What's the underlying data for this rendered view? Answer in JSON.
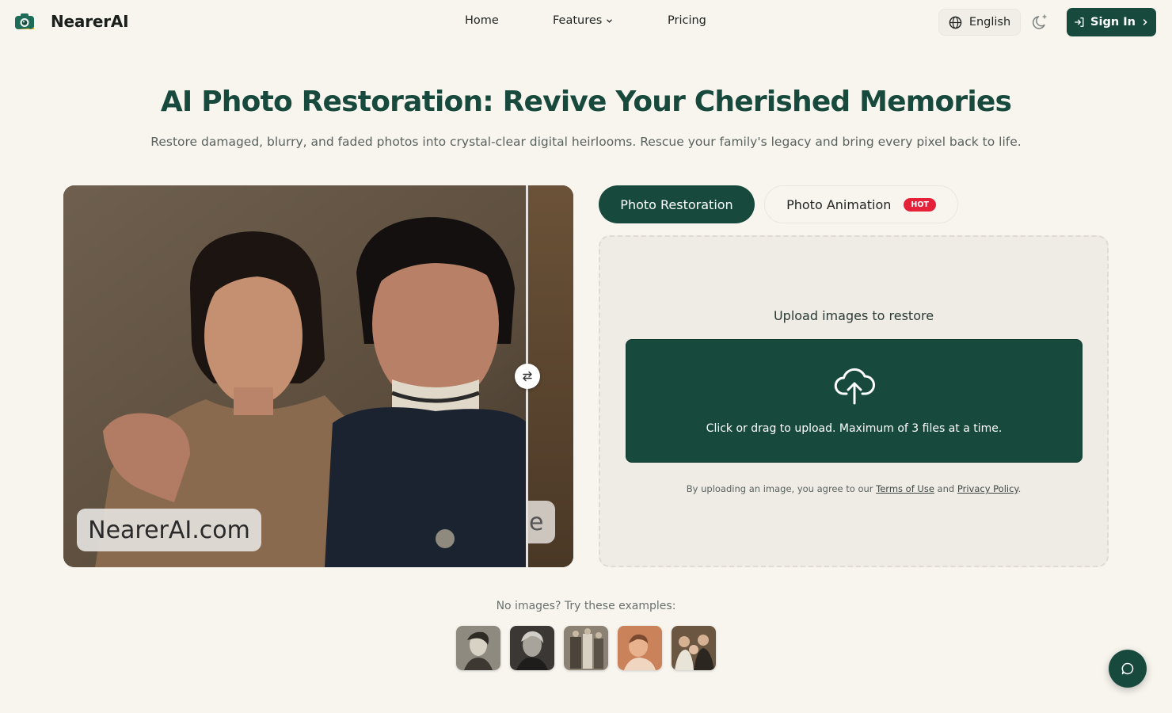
{
  "brand": {
    "name": "NearerAI",
    "logo_icon": "camera-icon"
  },
  "nav": {
    "items": [
      {
        "label": "Home"
      },
      {
        "label": "Features",
        "icon": "chevron-down-icon"
      },
      {
        "label": "Pricing"
      }
    ]
  },
  "header": {
    "language": {
      "label": "English",
      "icon": "globe-icon"
    },
    "theme_icon": "moon-sparkle-icon",
    "signin": {
      "label": "Sign In",
      "icon": "login-icon"
    }
  },
  "hero": {
    "title": "AI Photo Restoration: Revive Your Cherished Memories",
    "subtitle": "Restore damaged, blurry, and faded photos into crystal-clear digital heirlooms. Rescue your family's legacy and bring every pixel back to life."
  },
  "compare": {
    "watermark": "NearerAI.com",
    "watermark_old_fragment": "e",
    "handle_icon": "swap-arrows-icon"
  },
  "tabs": [
    {
      "label": "Photo Restoration",
      "active": true
    },
    {
      "label": "Photo Animation",
      "badge": "HOT",
      "active": false
    }
  ],
  "upload": {
    "label": "Upload images to restore",
    "icon": "cloud-upload-icon",
    "hint": "Click or drag to upload. Maximum of 3 files at a time.",
    "terms_prefix": "By uploading an image, you agree to our ",
    "terms_link": "Terms of Use",
    "terms_and": " and ",
    "privacy_link": "Privacy Policy",
    "terms_suffix": "."
  },
  "examples": {
    "label": "No images? Try these examples:",
    "count": 5
  },
  "chat": {
    "icon": "chat-bubble-icon"
  },
  "colors": {
    "background": "#f8f5ef",
    "primary": "#174a3d",
    "hot_badge": "#e5213a"
  }
}
